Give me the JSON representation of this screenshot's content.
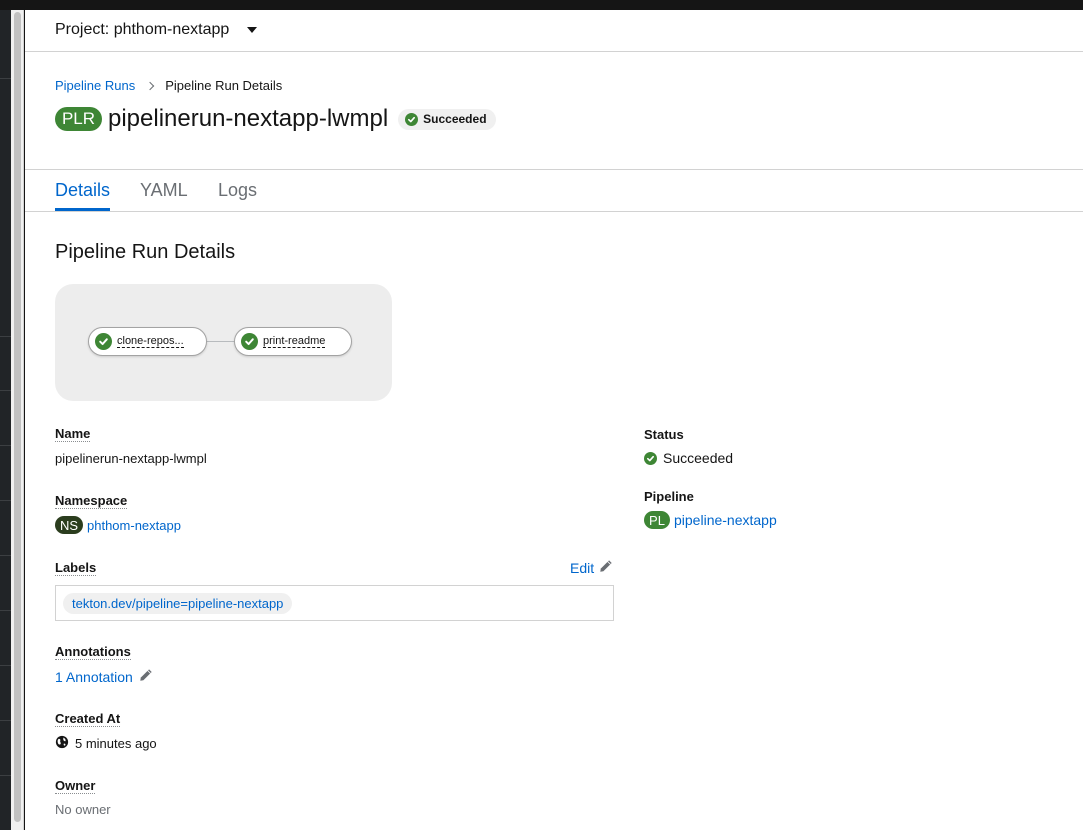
{
  "project": {
    "label": "Project: phthom-nextapp"
  },
  "breadcrumb": {
    "parent": "Pipeline Runs",
    "current": "Pipeline Run Details"
  },
  "header": {
    "badge": "PLR",
    "title": "pipelinerun-nextapp-lwmpl",
    "status": "Succeeded"
  },
  "tabs": [
    {
      "label": "Details",
      "active": true
    },
    {
      "label": "YAML",
      "active": false
    },
    {
      "label": "Logs",
      "active": false
    }
  ],
  "section_title": "Pipeline Run Details",
  "graph": {
    "tasks": [
      {
        "label": "clone-repos...",
        "status": "succeeded"
      },
      {
        "label": "print-readme",
        "status": "succeeded"
      }
    ]
  },
  "details": {
    "name_label": "Name",
    "name_value": "pipelinerun-nextapp-lwmpl",
    "namespace_label": "Namespace",
    "namespace_badge": "NS",
    "namespace_value": "phthom-nextapp",
    "labels_label": "Labels",
    "labels_edit": "Edit",
    "labels": [
      "tekton.dev/pipeline=pipeline-nextapp"
    ],
    "annotations_label": "Annotations",
    "annotations_value": "1 Annotation",
    "created_label": "Created At",
    "created_value": "5 minutes ago",
    "owner_label": "Owner",
    "owner_value": "No owner",
    "status_label": "Status",
    "status_value": "Succeeded",
    "pipeline_label": "Pipeline",
    "pipeline_badge": "PL",
    "pipeline_value": "pipeline-nextapp"
  },
  "colors": {
    "accent": "#0066cc",
    "success": "#3e8635",
    "namespace_badge": "#2b3d1e"
  },
  "icons": [
    "caret-down-icon",
    "chevron-right-icon",
    "check-circle-icon",
    "pencil-icon",
    "globe-icon"
  ]
}
